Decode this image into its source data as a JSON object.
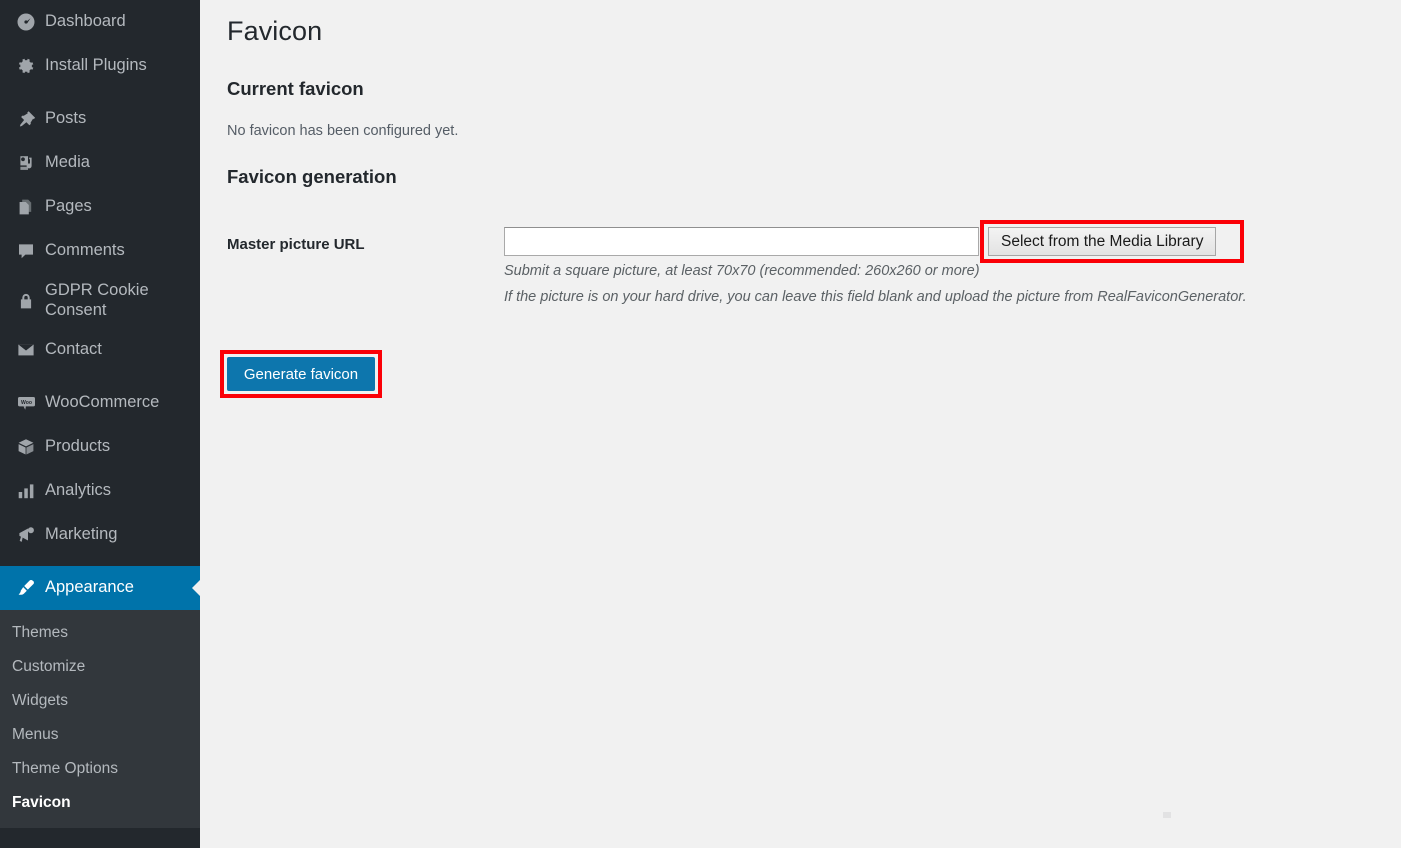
{
  "sidebar": {
    "items": [
      {
        "label": "Dashboard",
        "icon": "dashboard-icon",
        "current": false,
        "sep_after": false
      },
      {
        "label": "Install Plugins",
        "icon": "gear-icon",
        "current": false,
        "sep_after": true
      },
      {
        "label": "Posts",
        "icon": "pin-icon",
        "current": false,
        "sep_after": false
      },
      {
        "label": "Media",
        "icon": "media-icon",
        "current": false,
        "sep_after": false
      },
      {
        "label": "Pages",
        "icon": "pages-icon",
        "current": false,
        "sep_after": false
      },
      {
        "label": "Comments",
        "icon": "comment-icon",
        "current": false,
        "sep_after": false
      },
      {
        "label": "GDPR Cookie Consent",
        "icon": "lock-icon",
        "current": false,
        "sep_after": false
      },
      {
        "label": "Contact",
        "icon": "envelope-icon",
        "current": false,
        "sep_after": true
      },
      {
        "label": "WooCommerce",
        "icon": "woocommerce-icon",
        "current": false,
        "sep_after": false
      },
      {
        "label": "Products",
        "icon": "box-icon",
        "current": false,
        "sep_after": false
      },
      {
        "label": "Analytics",
        "icon": "bar-chart-icon",
        "current": false,
        "sep_after": false
      },
      {
        "label": "Marketing",
        "icon": "megaphone-icon",
        "current": false,
        "sep_after": true
      },
      {
        "label": "Appearance",
        "icon": "paintbrush-icon",
        "current": true,
        "sep_after": false
      }
    ],
    "submenu": [
      {
        "label": "Themes",
        "current": false
      },
      {
        "label": "Customize",
        "current": false
      },
      {
        "label": "Widgets",
        "current": false
      },
      {
        "label": "Menus",
        "current": false
      },
      {
        "label": "Theme Options",
        "current": false
      },
      {
        "label": "Favicon",
        "current": true
      }
    ]
  },
  "main": {
    "page_title": "Favicon",
    "current_favicon_heading": "Current favicon",
    "current_favicon_status": "No favicon has been configured yet.",
    "generation_heading": "Favicon generation",
    "master_picture_label": "Master picture URL",
    "master_picture_value": "",
    "master_picture_placeholder": "",
    "media_library_button": "Select from the Media Library",
    "help_line_1": "Submit a square picture, at least 70x70 (recommended: 260x260 or more)",
    "help_line_2": "If the picture is on your hard drive, you can leave this field blank and upload the picture from RealFaviconGenerator.",
    "generate_button": "Generate favicon"
  },
  "colors": {
    "sidebar_bg": "#23282d",
    "submenu_bg": "#32373c",
    "current_menu_bg": "#0073aa",
    "content_bg": "#f1f1f1",
    "highlight_red": "#fb0007",
    "primary_button_bg": "#0d76ad"
  }
}
